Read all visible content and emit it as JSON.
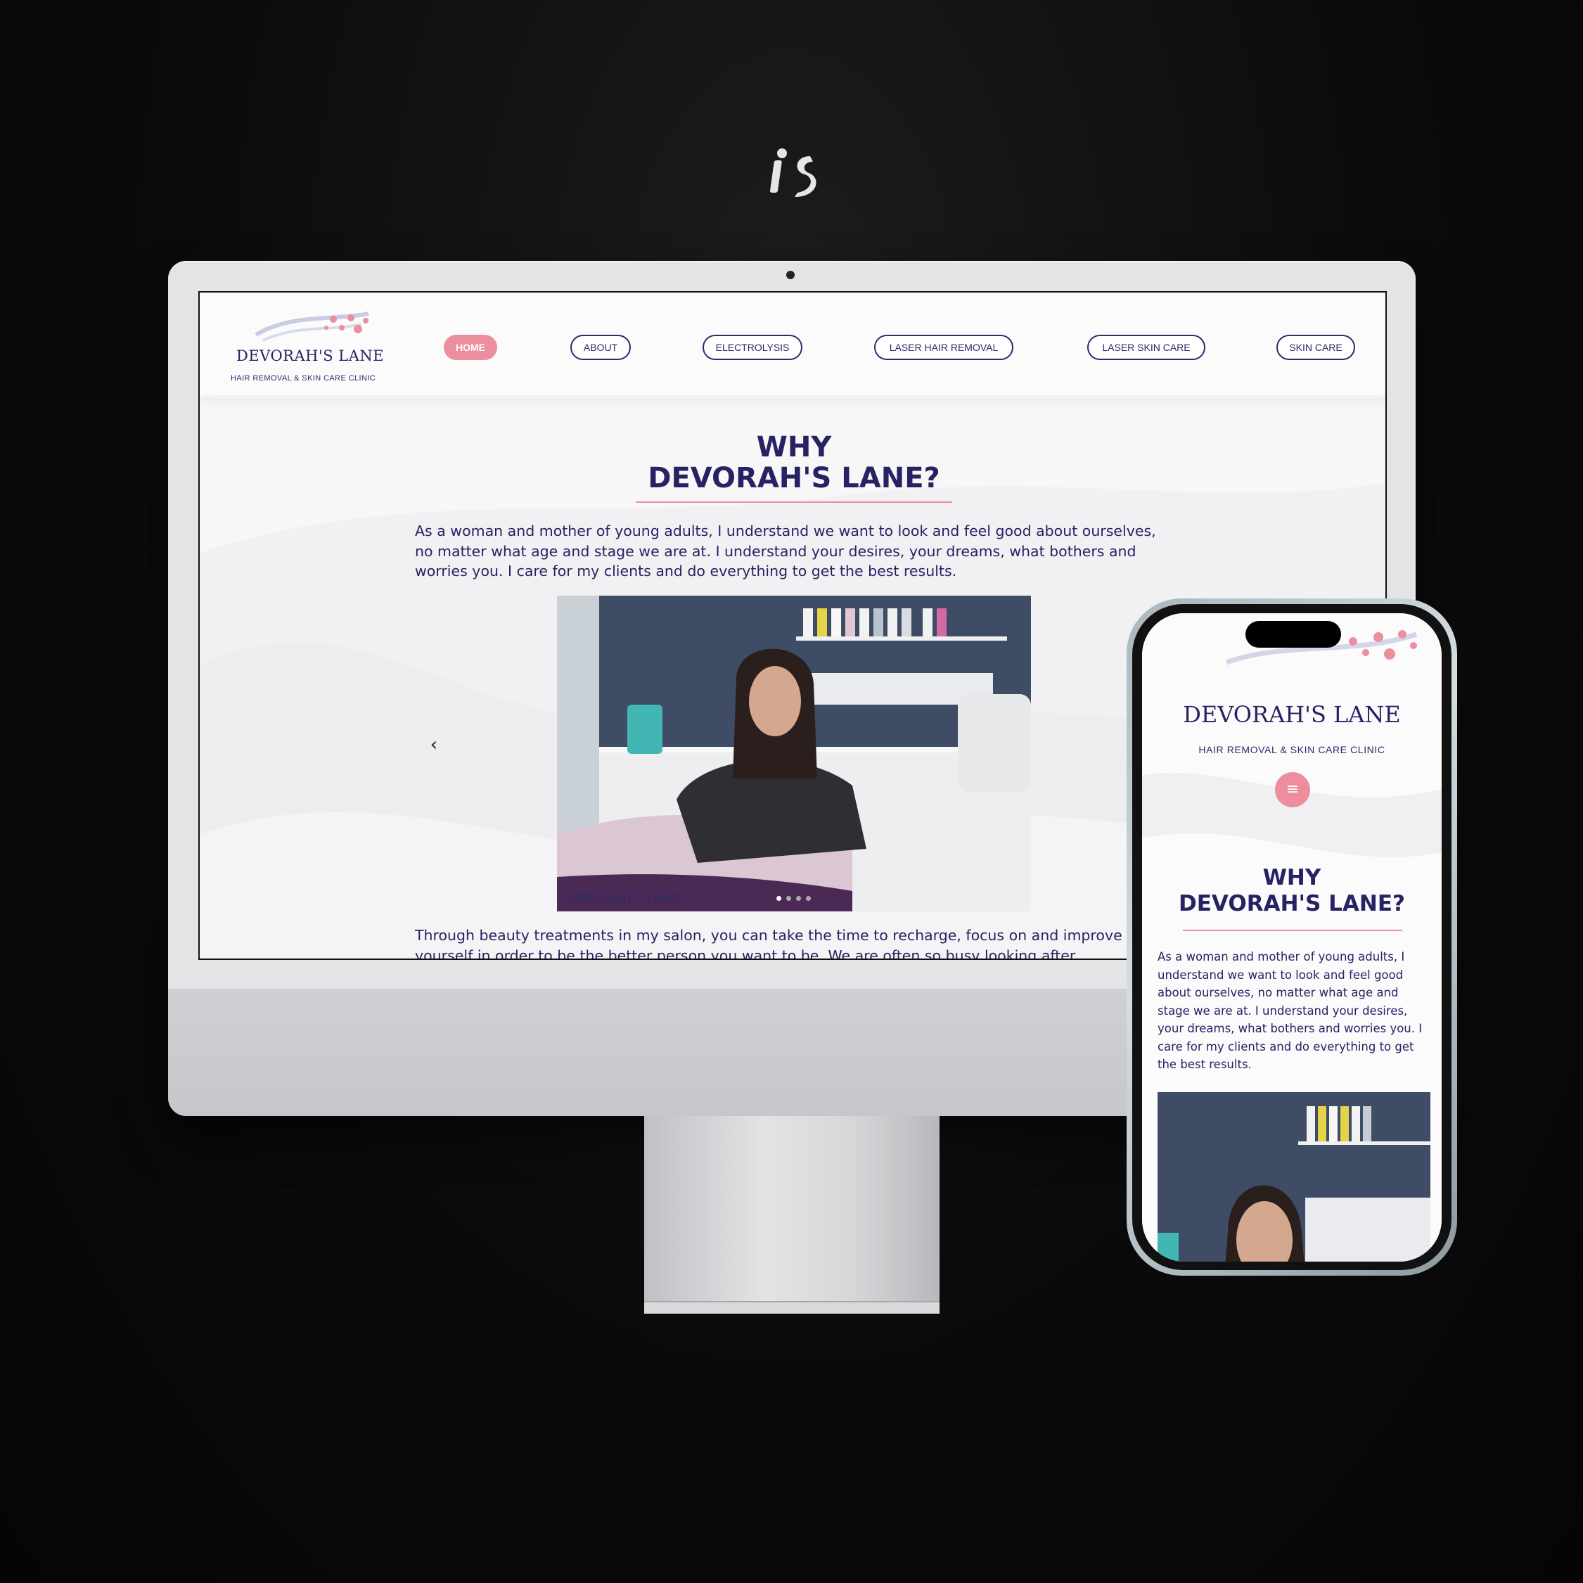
{
  "brand_mark": "is",
  "desktop": {
    "logo": {
      "name": "DEVORAH'S LANE",
      "tagline": "HAIR REMOVAL & SKIN CARE CLINIC"
    },
    "nav": [
      {
        "label": "HOME",
        "active": true
      },
      {
        "label": "ABOUT",
        "active": false
      },
      {
        "label": "ELECTROLYSIS",
        "active": false
      },
      {
        "label": "LASER HAIR REMOVAL",
        "active": false
      },
      {
        "label": "LASER SKIN CARE",
        "active": false
      },
      {
        "label": "SKIN CARE",
        "active": false
      }
    ],
    "heading_line1": "WHY",
    "heading_line2": "DEVORAH'S LANE?",
    "intro": "As a woman and mother of young adults, I understand we want to look and feel good about ourselves, no matter what age and stage we are at. I understand your desires, your dreams, what bothers and worries you. I care for my clients and do everything to get the best results.",
    "slide_watermark": "DEVORAH'S LANE",
    "slider_prev": "‹",
    "slider_total": 4,
    "slider_active": 1,
    "after_line1": "Through beauty treatments in my salon, you can take the time to recharge, focus on and improve",
    "after_line2": "yourself in order to be the better person you want to be. We are often so busy looking after"
  },
  "mobile": {
    "logo": {
      "name": "DEVORAH'S LANE",
      "tagline": "HAIR REMOVAL & SKIN CARE CLINIC"
    },
    "menu_icon": "≡",
    "heading_line1": "WHY",
    "heading_line2": "DEVORAH'S LANE?",
    "intro": "As a woman and mother of young adults, I understand we want to look and feel good about ourselves, no matter what age and stage we are at. I understand your desires, your dreams, what bothers and worries you. I care for my clients and do everything to get the best results."
  },
  "colors": {
    "navy": "#272263",
    "pink": "#ec8e9d",
    "background": "#0b0b0b"
  }
}
